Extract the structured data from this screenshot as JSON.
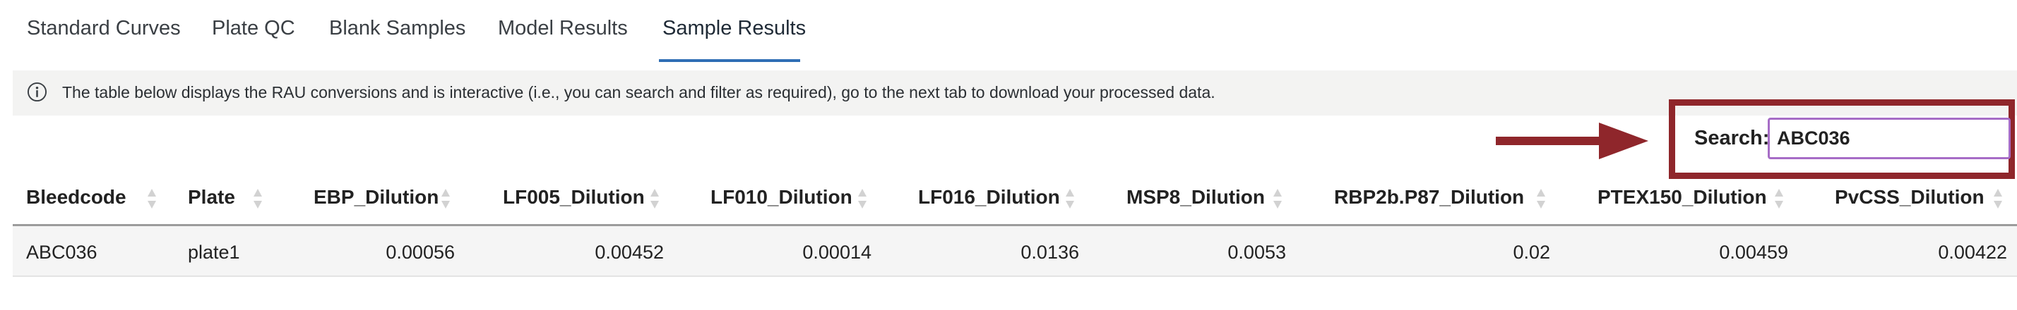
{
  "tabs": [
    {
      "label": "Standard Curves",
      "active": false
    },
    {
      "label": "Plate QC",
      "active": false
    },
    {
      "label": "Blank Samples",
      "active": false
    },
    {
      "label": "Model Results",
      "active": false
    },
    {
      "label": "Sample Results",
      "active": true
    }
  ],
  "banner": {
    "icon": "info-circle-icon",
    "text": "The table below displays the RAU conversions and is interactive (i.e., you can search and filter as required), go to the next tab to download your processed data."
  },
  "search": {
    "label": "Search:",
    "value": "ABC036"
  },
  "table": {
    "columns": [
      "Bleedcode",
      "Plate",
      "EBP_Dilution",
      "LF005_Dilution",
      "LF010_Dilution",
      "LF016_Dilution",
      "MSP8_Dilution",
      "RBP2b.P87_Dilution",
      "PTEX150_Dilution",
      "PvCSS_Dilution"
    ],
    "rows": [
      [
        "ABC036",
        "plate1",
        "0.00056",
        "0.00452",
        "0.00014",
        "0.0136",
        "0.0053",
        "0.02",
        "0.00459",
        "0.00422"
      ]
    ]
  },
  "colors": {
    "active_tab_underline": "#2f6eb5",
    "annotation": "#8f262b",
    "search_focus": "#a66cc6",
    "banner_bg": "#f3f3f2"
  }
}
